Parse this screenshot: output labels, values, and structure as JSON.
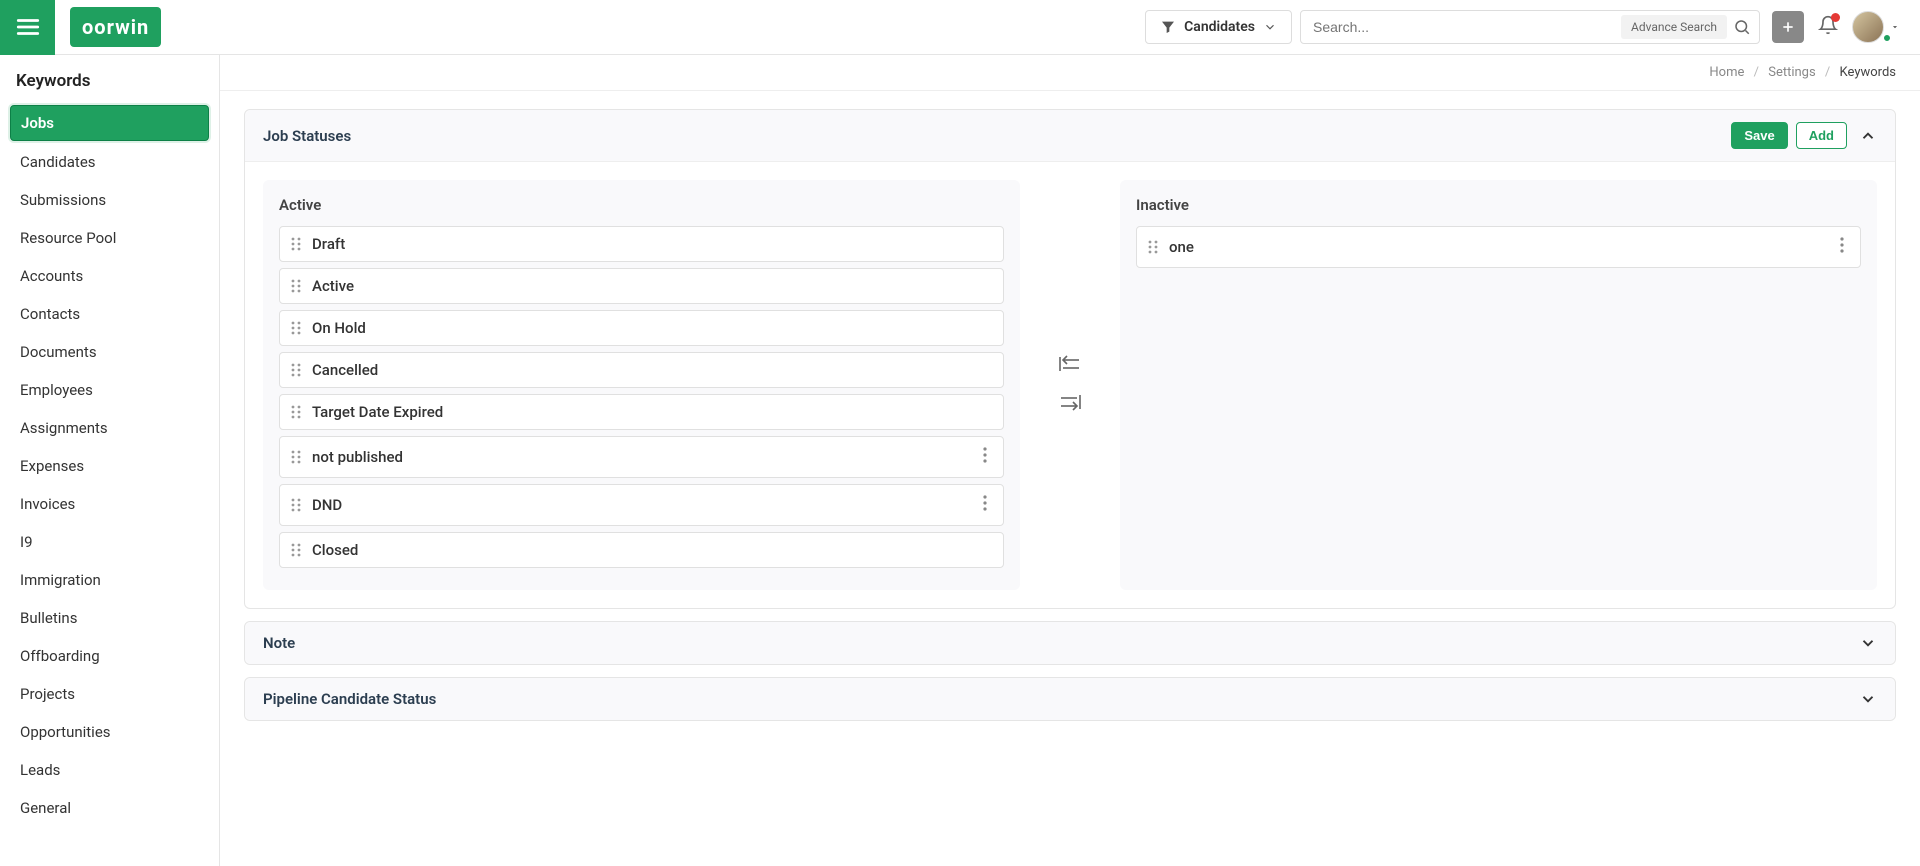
{
  "header": {
    "logo_text": "oorwin",
    "filter_label": "Candidates",
    "search_placeholder": "Search...",
    "advance_search_label": "Advance Search"
  },
  "sidebar": {
    "title": "Keywords",
    "items": [
      {
        "label": "Jobs",
        "active": true
      },
      {
        "label": "Candidates",
        "active": false
      },
      {
        "label": "Submissions",
        "active": false
      },
      {
        "label": "Resource Pool",
        "active": false
      },
      {
        "label": "Accounts",
        "active": false
      },
      {
        "label": "Contacts",
        "active": false
      },
      {
        "label": "Documents",
        "active": false
      },
      {
        "label": "Employees",
        "active": false
      },
      {
        "label": "Assignments",
        "active": false
      },
      {
        "label": "Expenses",
        "active": false
      },
      {
        "label": "Invoices",
        "active": false
      },
      {
        "label": "I9",
        "active": false
      },
      {
        "label": "Immigration",
        "active": false
      },
      {
        "label": "Bulletins",
        "active": false
      },
      {
        "label": "Offboarding",
        "active": false
      },
      {
        "label": "Projects",
        "active": false
      },
      {
        "label": "Opportunities",
        "active": false
      },
      {
        "label": "Leads",
        "active": false
      },
      {
        "label": "General",
        "active": false
      }
    ]
  },
  "breadcrumb": {
    "home": "Home",
    "settings": "Settings",
    "current": "Keywords"
  },
  "panels": {
    "job_statuses": {
      "title": "Job Statuses",
      "save_label": "Save",
      "add_label": "Add",
      "active_title": "Active",
      "inactive_title": "Inactive",
      "active_items": [
        {
          "label": "Draft",
          "menu": false
        },
        {
          "label": "Active",
          "menu": false
        },
        {
          "label": "On Hold",
          "menu": false
        },
        {
          "label": "Cancelled",
          "menu": false
        },
        {
          "label": "Target Date Expired",
          "menu": false
        },
        {
          "label": "not published",
          "menu": true
        },
        {
          "label": "DND",
          "menu": true
        },
        {
          "label": "Closed",
          "menu": false
        }
      ],
      "inactive_items": [
        {
          "label": "one",
          "menu": true
        }
      ]
    },
    "note": {
      "title": "Note"
    },
    "pipeline": {
      "title": "Pipeline Candidate Status"
    }
  }
}
